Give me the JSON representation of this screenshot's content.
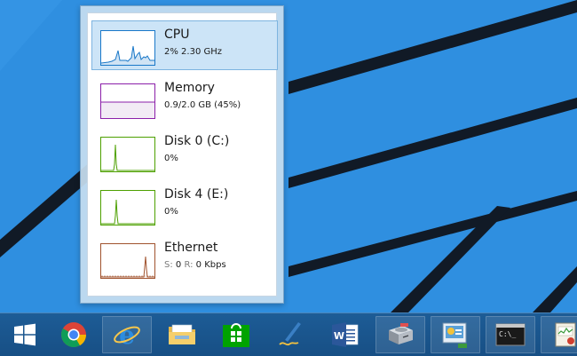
{
  "task_manager": {
    "items": [
      {
        "title": "CPU",
        "value": "2%  2.30 GHz",
        "color": "#1a78c8",
        "selected": true
      },
      {
        "title": "Memory",
        "value": "0.9/2.0 GB (45%)",
        "color": "#8b1fa9",
        "selected": false
      },
      {
        "title": "Disk 0 (C:)",
        "value": "0%",
        "color": "#4da000",
        "selected": false
      },
      {
        "title": "Disk 4 (E:)",
        "value": "0%",
        "color": "#4da000",
        "selected": false
      },
      {
        "title": "Ethernet",
        "value_send_label": "S:",
        "value_send": "0",
        "value_recv_label": "R:",
        "value_recv": "0 Kbps",
        "color": "#a0522d",
        "selected": false
      }
    ]
  },
  "taskbar": {
    "buttons": [
      {
        "name": "start",
        "icon": "windows-logo-icon"
      },
      {
        "name": "chrome",
        "icon": "chrome-icon"
      },
      {
        "name": "internet-explorer",
        "icon": "ie-icon"
      },
      {
        "name": "file-explorer",
        "icon": "folder-icon"
      },
      {
        "name": "store",
        "icon": "store-icon"
      },
      {
        "name": "pen-app",
        "icon": "pen-icon"
      },
      {
        "name": "word",
        "icon": "word-icon"
      },
      {
        "name": "disk-management",
        "icon": "hard-drive-icon"
      },
      {
        "name": "network-app",
        "icon": "network-icon"
      },
      {
        "name": "command-prompt",
        "icon": "cmd-icon"
      },
      {
        "name": "task-manager",
        "icon": "task-manager-icon"
      }
    ]
  }
}
